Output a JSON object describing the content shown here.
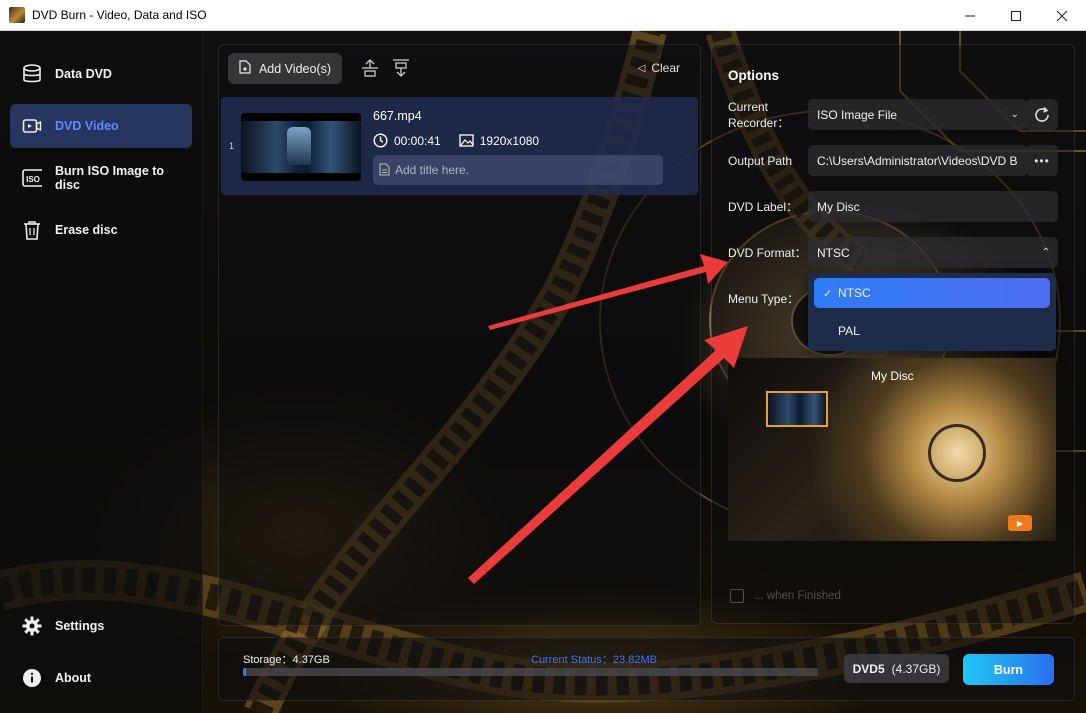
{
  "window": {
    "title": "DVD Burn - Video, Data and ISO",
    "controls": [
      "minimize",
      "maximize",
      "close"
    ]
  },
  "sidebar": {
    "items": [
      {
        "label": "Data DVD",
        "icon": "database-icon",
        "active": false
      },
      {
        "label": "DVD Video",
        "icon": "video-icon",
        "active": true
      },
      {
        "label": "Burn ISO Image to disc",
        "icon": "iso-icon",
        "active": false
      },
      {
        "label": "Erase disc",
        "icon": "trash-icon",
        "active": false
      }
    ],
    "bottom_items": [
      {
        "label": "Settings",
        "icon": "gear-icon"
      },
      {
        "label": "About",
        "icon": "info-icon"
      }
    ]
  },
  "filelist": {
    "add_label": "Add Video(s)",
    "clear_label": "Clear",
    "files": [
      {
        "index": "1",
        "name": "667.mp4",
        "duration": "00:00:41",
        "resolution": "1920x1080",
        "title_placeholder": "Add title here."
      }
    ]
  },
  "options": {
    "heading": "Options",
    "recorder_label": "Current\nRecorder：",
    "recorder_value": "ISO Image File",
    "output_label": "Output Path",
    "output_value": "C:\\Users\\Administrator\\Videos\\DVD B",
    "dvd_label_label": "DVD Label：",
    "dvd_label_value": "My Disc",
    "dvd_format_label": "DVD Format：",
    "dvd_format_value": "NTSC",
    "menu_type_label": "Menu Type：",
    "format_options": [
      "NTSC",
      "PAL"
    ],
    "format_selected": "NTSC",
    "preview_title": "My Disc",
    "finished_text": "... when Finished"
  },
  "bottom": {
    "storage": "Storage：4.37GB",
    "current_status": "Current Status：23.82MB",
    "progress_fraction": 0.005,
    "disc_type": "DVD5",
    "disc_capacity": "(4.37GB)",
    "burn_label": "Burn"
  },
  "colors": {
    "accent_blue": "#2f7df6",
    "active_nav_bg": "#2c3e6e",
    "status_blue": "#3f73ff",
    "annotation_red": "#ec3b3b",
    "preview_play": "#f07a18"
  }
}
